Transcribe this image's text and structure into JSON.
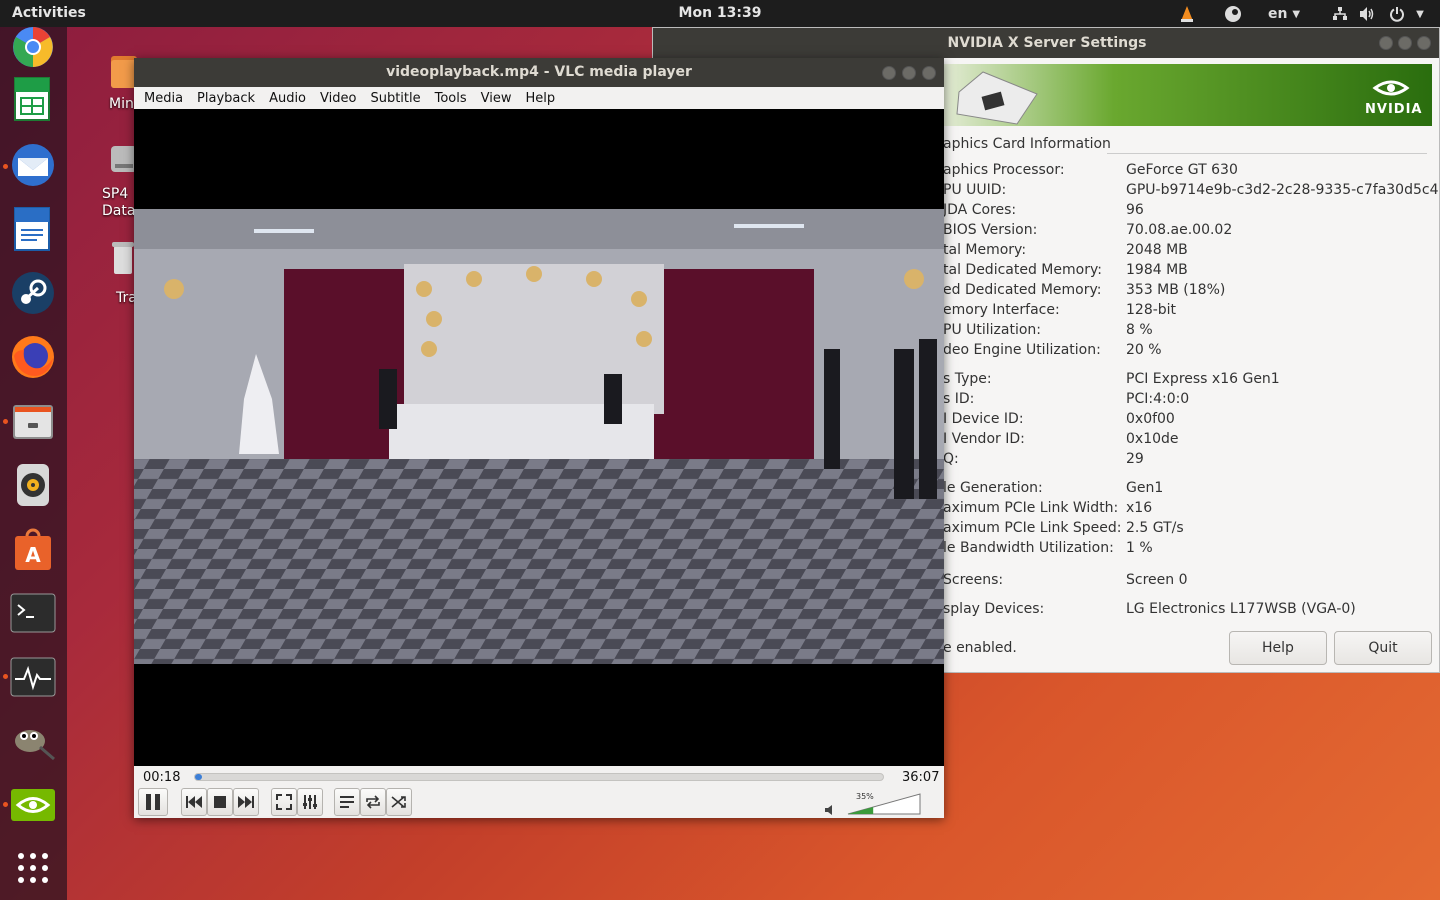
{
  "topbar": {
    "activities": "Activities",
    "clock": "Mon 13:39",
    "lang": "en"
  },
  "dock": {
    "items": [
      "Chromium",
      "LibreOffice Calc",
      "Thunderbird",
      "LibreOffice Writer",
      "Steam",
      "Firefox",
      "Files",
      "Rhythmbox",
      "Ubuntu Software",
      "Terminal",
      "System Monitor",
      "GIMP",
      "NVIDIA Settings",
      "Show Applications"
    ]
  },
  "desktop": {
    "icons": [
      {
        "label": "Min"
      },
      {
        "label": "SP4\nData"
      },
      {
        "label": "Tra"
      }
    ]
  },
  "nvidia": {
    "title": "NVIDIA X Server Settings",
    "brand": "NVIDIA",
    "section": "aphics Card Information",
    "rows": [
      {
        "label": "aphics Processor:",
        "value": "GeForce GT 630"
      },
      {
        "label": "PU UUID:",
        "value": "GPU-b9714e9b-c3d2-2c28-9335-c7fa30d5c48f"
      },
      {
        "label": "JDA Cores:",
        "value": "96"
      },
      {
        "label": "BIOS Version:",
        "value": "70.08.ae.00.02"
      },
      {
        "label": "tal Memory:",
        "value": "2048 MB"
      },
      {
        "label": "tal Dedicated Memory:",
        "value": "1984 MB"
      },
      {
        "label": "ed Dedicated Memory:",
        "value": "353 MB (18%)"
      },
      {
        "label": "emory Interface:",
        "value": "128-bit"
      },
      {
        "label": "PU Utilization:",
        "value": "8 %"
      },
      {
        "label": "deo Engine Utilization:",
        "value": "20 %"
      },
      {
        "label": "s Type:",
        "value": "PCI Express x16 Gen1"
      },
      {
        "label": "s ID:",
        "value": "PCI:4:0:0"
      },
      {
        "label": "I Device ID:",
        "value": "0x0f00"
      },
      {
        "label": "I Vendor ID:",
        "value": "0x10de"
      },
      {
        "label": "Q:",
        "value": "29"
      },
      {
        "label": "le Generation:",
        "value": "Gen1"
      },
      {
        "label": "aximum PCIe Link Width:",
        "value": "x16"
      },
      {
        "label": "aximum PCIe Link Speed:",
        "value": "2.5 GT/s"
      },
      {
        "label": "le Bandwidth Utilization:",
        "value": "1 %"
      },
      {
        "label": "Screens:",
        "value": "Screen 0"
      },
      {
        "label": "splay Devices:",
        "value": "LG Electronics L177WSB (VGA-0)"
      }
    ],
    "status": "e enabled.",
    "help": "Help",
    "quit": "Quit"
  },
  "vlc": {
    "title": "videoplayback.mp4 - VLC media player",
    "menu": [
      "Media",
      "Playback",
      "Audio",
      "Video",
      "Subtitle",
      "Tools",
      "View",
      "Help"
    ],
    "elapsed": "00:18",
    "duration": "36:07",
    "progress": 0.008,
    "volume": "35%",
    "volume_level": 0.35
  },
  "colors": {
    "accent": "#e95420",
    "vlc_progress": "#3d7fd6",
    "nvidia_green": "#76b900"
  }
}
